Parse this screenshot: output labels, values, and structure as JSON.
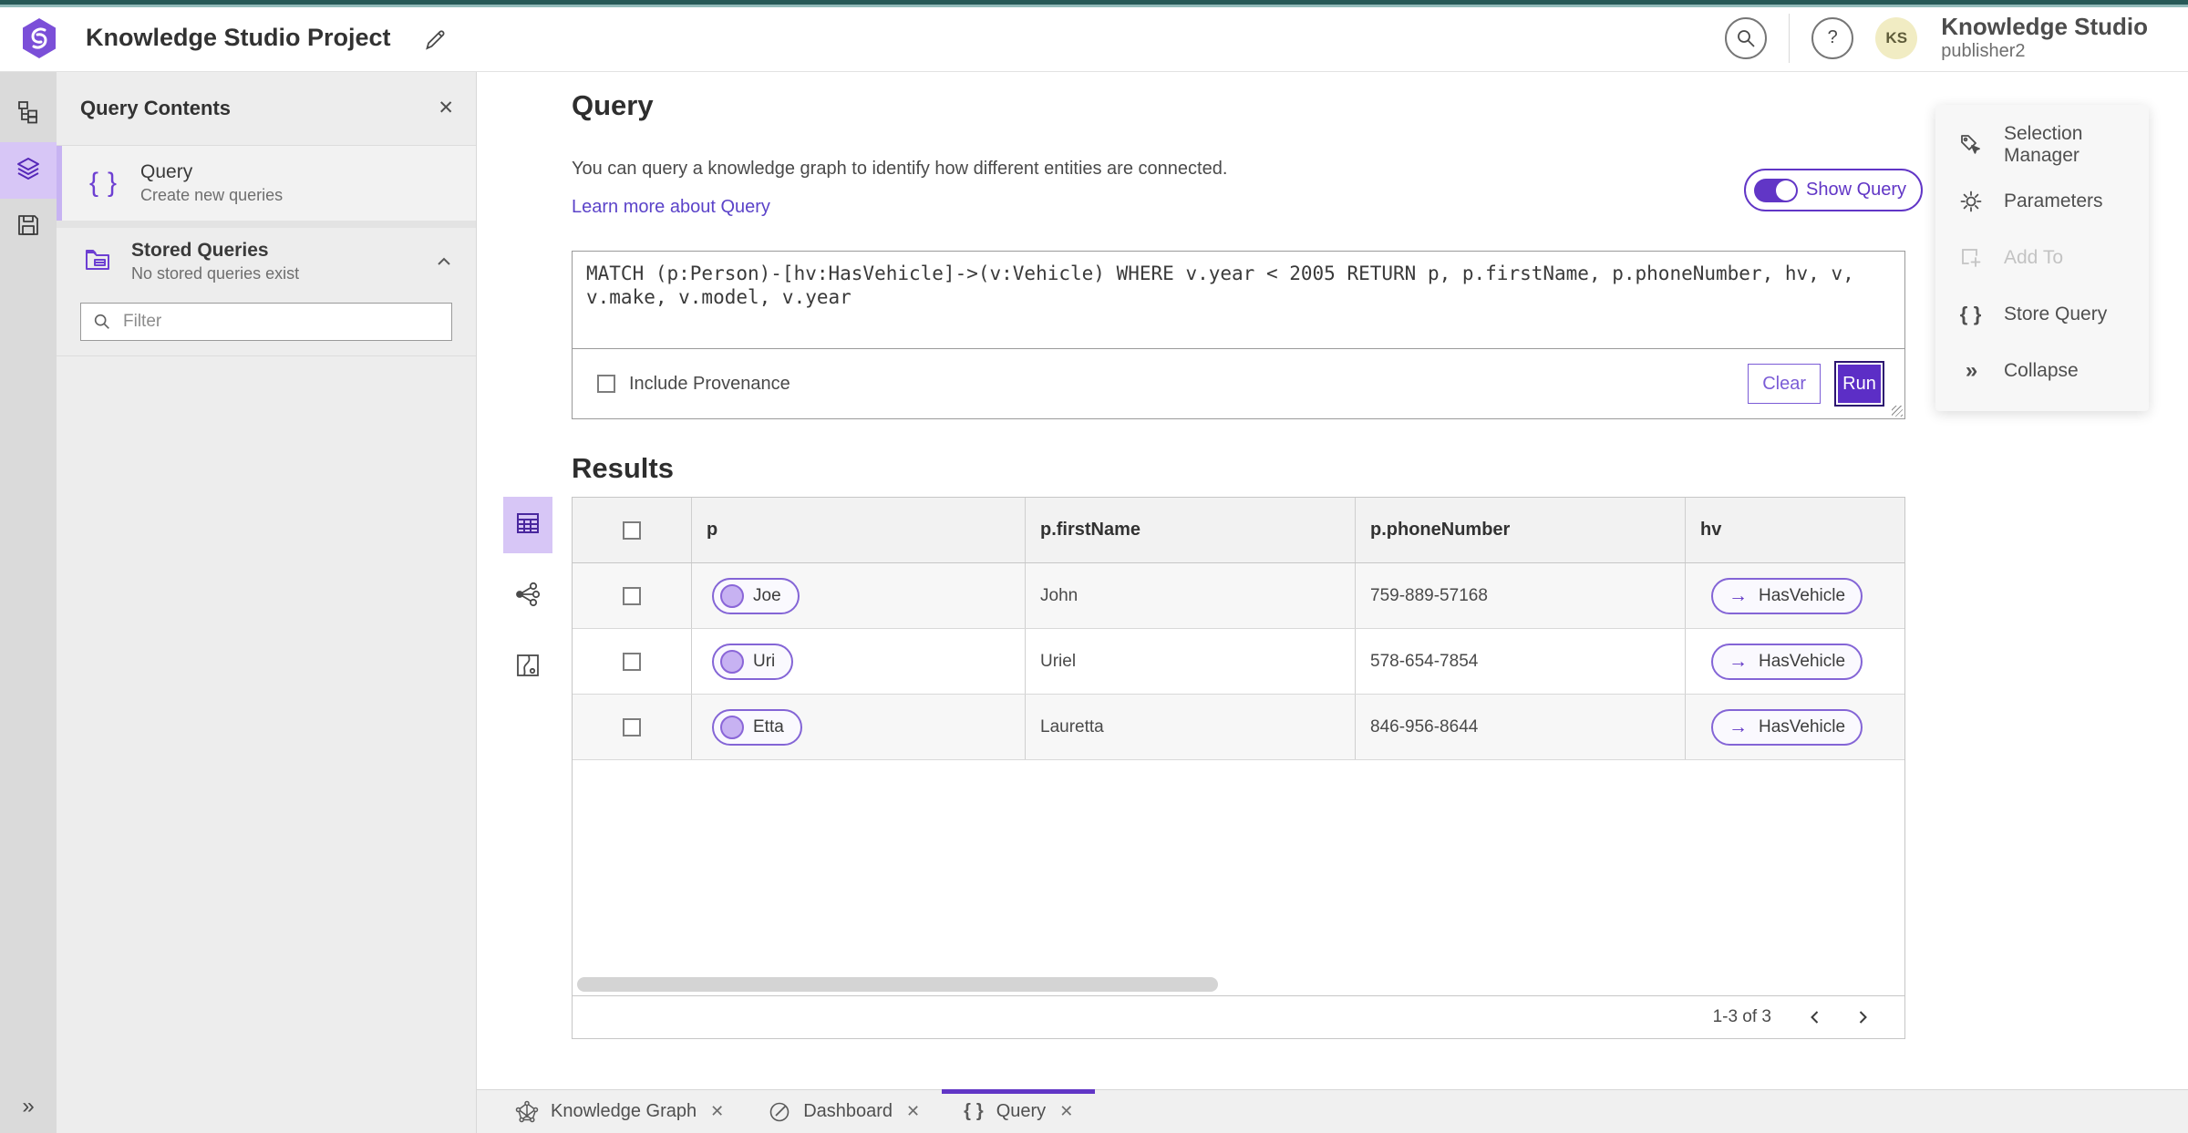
{
  "topbar": {
    "title": "Knowledge Studio Project",
    "user_name": "Knowledge Studio",
    "user_role": "publisher2",
    "avatar_initials": "KS",
    "help_glyph": "?"
  },
  "contents_panel": {
    "title": "Query Contents",
    "query_item": {
      "title": "Query",
      "subtitle": "Create new queries"
    },
    "stored_item": {
      "title": "Stored Queries",
      "subtitle": "No stored queries exist"
    },
    "filter_placeholder": "Filter"
  },
  "query_section": {
    "heading": "Query",
    "description": "You can query a knowledge graph to identify how different entities are connected.",
    "learn_more": "Learn more about Query",
    "show_query_label": "Show Query",
    "query_text": "MATCH (p:Person)-[hv:HasVehicle]->(v:Vehicle) WHERE v.year < 2005 RETURN p, p.firstName, p.phoneNumber, hv, v, v.make, v.model, v.year",
    "include_provenance_label": "Include Provenance",
    "clear_label": "Clear",
    "run_label": "Run"
  },
  "results": {
    "heading": "Results",
    "columns": [
      "p",
      "p.firstName",
      "p.phoneNumber",
      "hv"
    ],
    "rows": [
      {
        "p": "Joe",
        "firstName": "John",
        "phoneNumber": "759-889-57168",
        "hv": "HasVehicle"
      },
      {
        "p": "Uri",
        "firstName": "Uriel",
        "phoneNumber": "578-654-7854",
        "hv": "HasVehicle"
      },
      {
        "p": "Etta",
        "firstName": "Lauretta",
        "phoneNumber": "846-956-8644",
        "hv": "HasVehicle"
      }
    ],
    "pagination": "1-3 of 3"
  },
  "tools_menu": {
    "items": [
      {
        "label": "Selection Manager",
        "icon": "selection-manager-icon",
        "disabled": false
      },
      {
        "label": "Parameters",
        "icon": "gear-icon",
        "disabled": false
      },
      {
        "label": "Add To",
        "icon": "add-to-icon",
        "disabled": true
      },
      {
        "label": "Store Query",
        "icon": "braces-icon",
        "disabled": false
      },
      {
        "label": "Collapse",
        "icon": "double-chevron-right-icon",
        "disabled": false
      }
    ]
  },
  "tabs": [
    {
      "label": "Knowledge Graph",
      "icon": "knowledge-graph-icon",
      "active": false
    },
    {
      "label": "Dashboard",
      "icon": "dashboard-icon",
      "active": false
    },
    {
      "label": "Query",
      "icon": "braces-icon",
      "active": true
    }
  ],
  "left_rail_icons": [
    "data-model-icon",
    "layers-icon",
    "save-icon",
    "expand-icon"
  ],
  "colors": {
    "accent_purple": "#6136c6",
    "accent_purple_light": "#d7c6f6",
    "run_button": "#5c2ec6",
    "teal_dark": "#275957",
    "teal_light": "#93bbba",
    "table_header_bg": "#f2f2f2",
    "row_alt_bg": "#f7f7f7",
    "avatar_bg": "#f1ecc3"
  }
}
